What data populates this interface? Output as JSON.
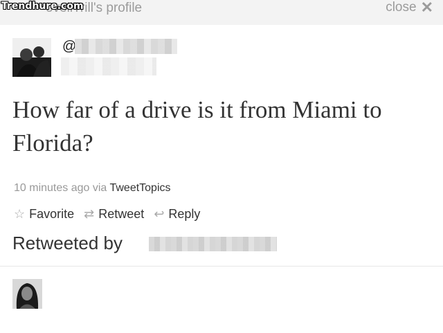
{
  "header": {
    "title": "oveliTrill's profile",
    "watermark": "Trendhure.com",
    "close_label": "close",
    "close_icon": "✕"
  },
  "tweet": {
    "at_symbol": "@",
    "text": "How far of a drive is it from Miami to Florida?",
    "timestamp": "10 minutes ago",
    "via_label": "via",
    "via_app": "TweetTopics",
    "actions": {
      "favorite": "Favorite",
      "retweet": "Retweet",
      "reply": "Reply"
    },
    "retweeted_by_label": "Retweeted by"
  },
  "colors": {
    "header_bg": "#f3f3f3",
    "muted_text": "#999999",
    "body_text": "#333333"
  }
}
